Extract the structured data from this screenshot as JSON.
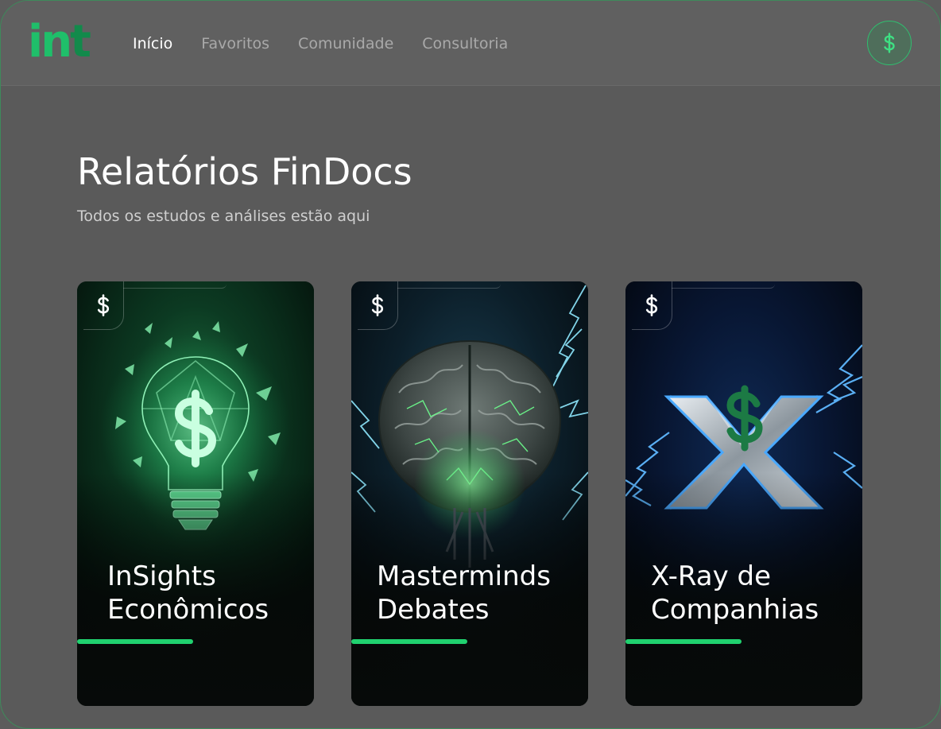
{
  "header": {
    "logo_text_a": "in",
    "logo_text_b": "t",
    "nav": [
      {
        "label": "Início",
        "active": true
      },
      {
        "label": "Favoritos",
        "active": false
      },
      {
        "label": "Comunidade",
        "active": false
      },
      {
        "label": "Consultoria",
        "active": false
      }
    ],
    "user_icon": "dollar-icon"
  },
  "main": {
    "title": "Relatórios FinDocs",
    "subtitle": "Todos os estudos e análises estão aqui"
  },
  "cards": [
    {
      "line1": "InSights",
      "line2": "Econômicos",
      "art": "lightbulb-dollar",
      "accent": "#21c76a"
    },
    {
      "line1": "Masterminds",
      "line2": "Debates",
      "art": "brain-lightning",
      "accent": "#38c9e8"
    },
    {
      "line1": "X-Ray de",
      "line2": "Companhias",
      "art": "x-dollar-lightning",
      "accent": "#2f8cff"
    }
  ],
  "colors": {
    "brand": "#1fbf6a",
    "brand_dark": "#128a4b",
    "progress": "#20d16f",
    "background": "#5a5a5a"
  }
}
